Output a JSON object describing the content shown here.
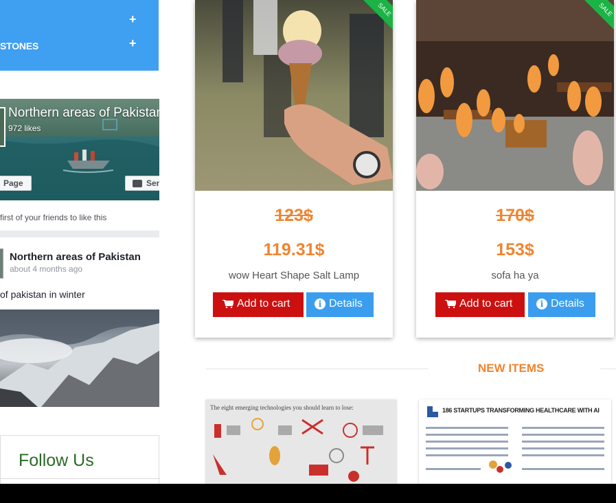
{
  "sidebar": {
    "categories": [
      {
        "label": "",
        "icon": "plus-icon"
      },
      {
        "label": "STONES",
        "icon": "plus-icon"
      }
    ],
    "facebook": {
      "page_name": "Northern areas of Pakistan",
      "likes": "972 likes",
      "like_page_button": "Page",
      "send_button": "Send",
      "friends_text": "first of your friends to like this",
      "post": {
        "author": "Northern areas of Pakistan",
        "time": "about 4 months ago",
        "text": "of pakistan in winter"
      }
    },
    "follow_us": "Follow Us"
  },
  "products": [
    {
      "old_price": "123$",
      "new_price": "119.31$",
      "name": "wow Heart Shape Salt Lamp",
      "badge": "SALE",
      "add_to_cart": "Add to cart",
      "details": "Details"
    },
    {
      "old_price": "170$",
      "new_price": "153$",
      "name": "sofa ha ya",
      "badge": "SALE",
      "add_to_cart": "Add to cart",
      "details": "Details"
    }
  ],
  "new_items": {
    "heading": "NEW ITEMS",
    "items": [
      {
        "caption": "The eight emerging technologies you should learn to lose:"
      },
      {
        "caption": "186 STARTUPS TRANSFORMING HEALTHCARE WITH AI"
      }
    ]
  },
  "colors": {
    "sidebar_blue": "#3f9ff0",
    "price_orange": "#f0842f",
    "cart_red": "#cc1010",
    "details_blue": "#3a9dee",
    "sale_green": "#1bb345",
    "follow_green": "#2a6a27"
  }
}
